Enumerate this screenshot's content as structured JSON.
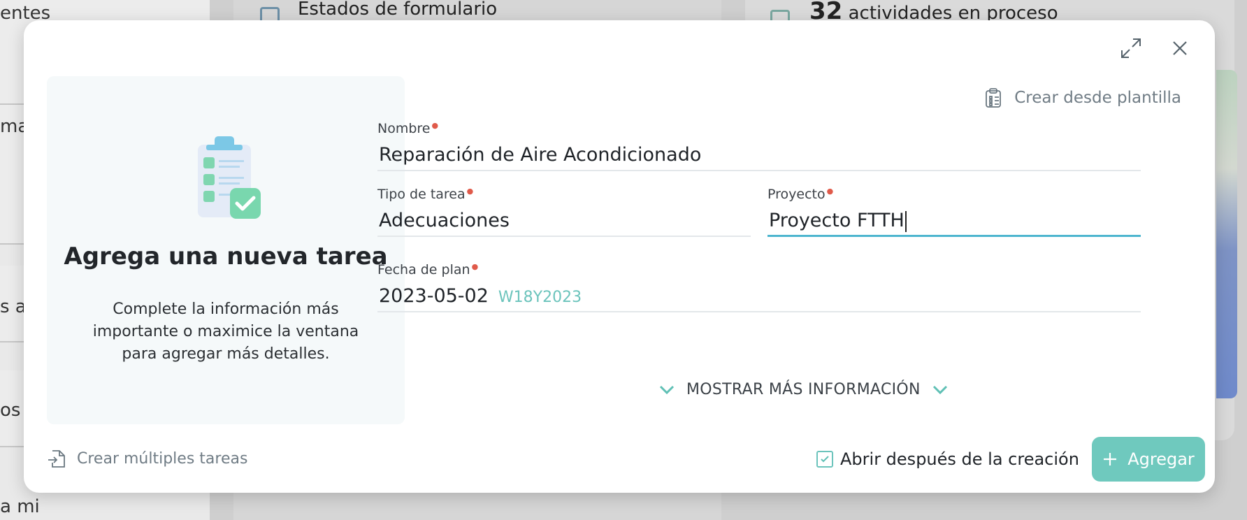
{
  "background": {
    "left_snippets": [
      "entes",
      "mar",
      "s a",
      "os a",
      "a mi"
    ],
    "col2_title": "Estados de formulario",
    "col3_count": "32",
    "col3_text": "actividades en proceso"
  },
  "modal": {
    "left_panel": {
      "title": "Agrega una nueva tarea",
      "description": "Complete la información más importante o maximice la ventana para agregar más detalles."
    },
    "template_link": "Crear desde plantilla",
    "fields": {
      "nombre": {
        "label": "Nombre",
        "value": "Reparación de Aire Acondicionado"
      },
      "tipo": {
        "label": "Tipo de tarea",
        "value": "Adecuaciones"
      },
      "proyecto": {
        "label": "Proyecto",
        "value": "Proyecto FTTH"
      },
      "fecha": {
        "label": "Fecha de plan",
        "value": "2023-05-02",
        "week": "W18Y2023"
      }
    },
    "more_info": "MOSTRAR MÁS INFORMACIÓN",
    "footer": {
      "multi_tasks": "Crear múltiples tareas",
      "open_after": "Abrir después de la creación",
      "open_after_checked": true,
      "add_button": "Agregar"
    }
  },
  "colors": {
    "accent_teal": "#6fc9be",
    "active_underline": "#4eb6cf",
    "required_mark": "#e05a4a"
  }
}
